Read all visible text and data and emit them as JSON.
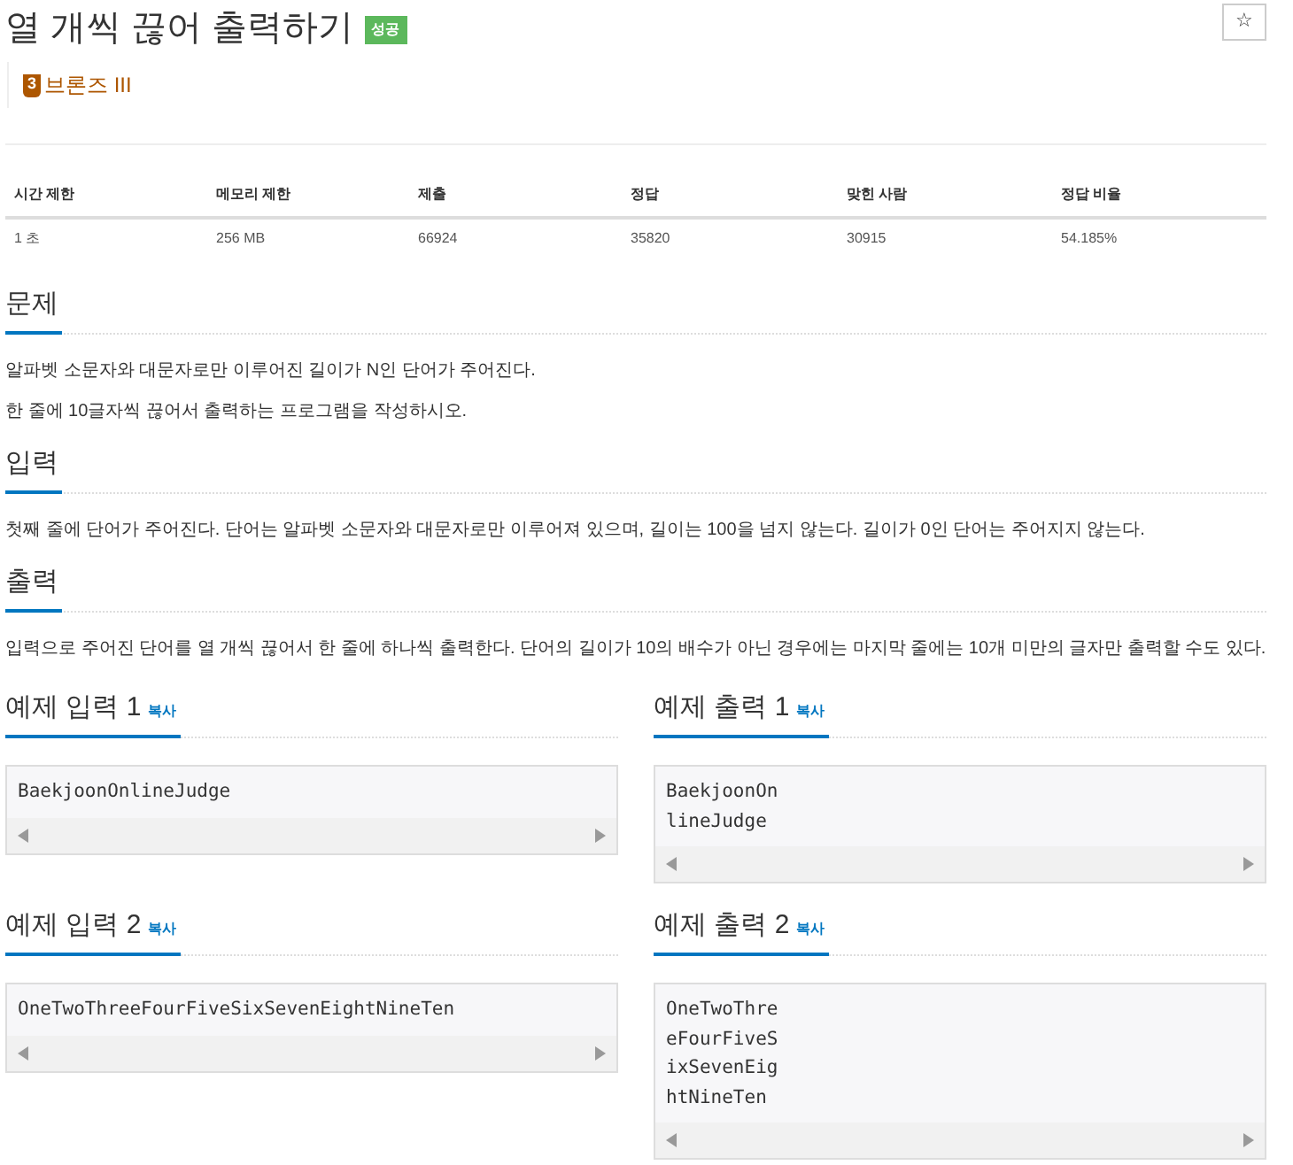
{
  "title": "열 개씩 끊어 출력하기",
  "status_badge": "성공",
  "star_button": "☆",
  "tier": {
    "level": "3",
    "label": "브론즈 III"
  },
  "stats": {
    "columns": [
      "시간 제한",
      "메모리 제한",
      "제출",
      "정답",
      "맞힌 사람",
      "정답 비율"
    ],
    "values": [
      "1 초",
      "256 MB",
      "66924",
      "35820",
      "30915",
      "54.185%"
    ]
  },
  "sections": [
    {
      "heading": "문제",
      "paragraphs": [
        "알파벳 소문자와 대문자로만 이루어진 길이가 N인 단어가 주어진다.",
        "한 줄에 10글자씩 끊어서 출력하는 프로그램을 작성하시오."
      ]
    },
    {
      "heading": "입력",
      "paragraphs": [
        "첫째 줄에 단어가 주어진다. 단어는 알파벳 소문자와 대문자로만 이루어져 있으며, 길이는 100을 넘지 않는다. 길이가 0인 단어는 주어지지 않는다."
      ]
    },
    {
      "heading": "출력",
      "paragraphs": [
        "입력으로 주어진 단어를 열 개씩 끊어서 한 줄에 하나씩 출력한다. 단어의 길이가 10의 배수가 아닌 경우에는 마지막 줄에는 10개 미만의 글자만 출력할 수도 있다."
      ]
    }
  ],
  "samples": [
    {
      "heading": "예제 입력 1",
      "copy": "복사",
      "lines": [
        "BaekjoonOnlineJudge"
      ]
    },
    {
      "heading": "예제 출력 1",
      "copy": "복사",
      "lines": [
        "BaekjoonOn",
        "lineJudge"
      ]
    },
    {
      "heading": "예제 입력 2",
      "copy": "복사",
      "lines": [
        "OneTwoThreeFourFiveSixSevenEightNineTen"
      ]
    },
    {
      "heading": "예제 출력 2",
      "copy": "복사",
      "lines": [
        "OneTwoThre",
        "eFourFiveS",
        "ixSevenEig",
        "htNineTen"
      ]
    }
  ]
}
